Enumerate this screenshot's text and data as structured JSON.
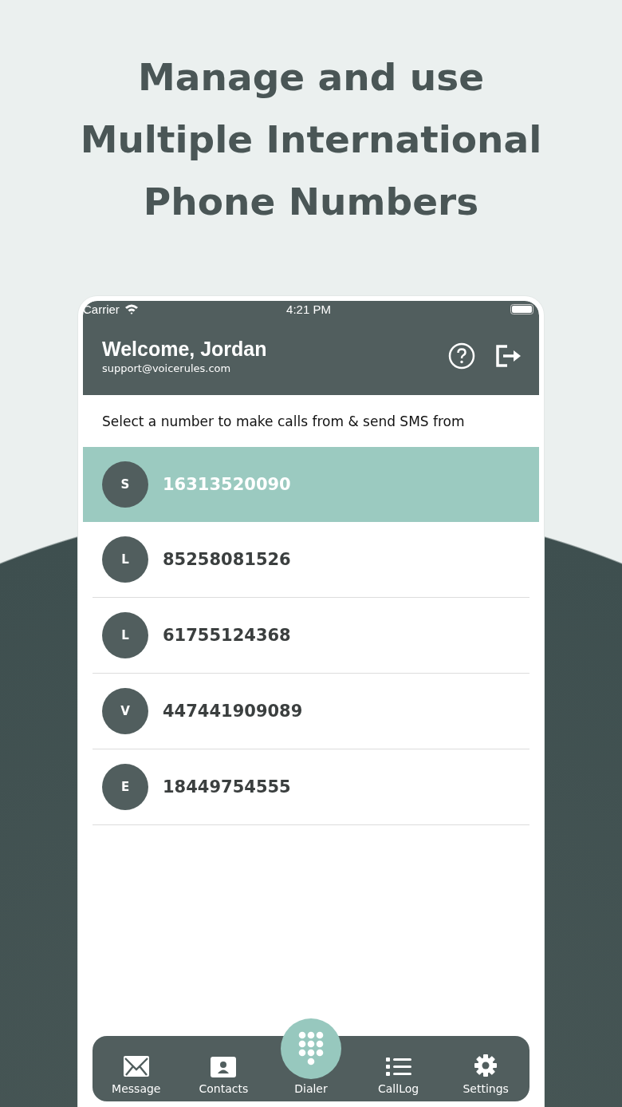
{
  "headline": [
    "Manage and use",
    "Multiple International",
    "Phone Numbers"
  ],
  "status_bar": {
    "carrier": "Carrier",
    "time": "4:21 PM"
  },
  "header": {
    "title": "Welcome, Jordan",
    "email": "support@voicerules.com"
  },
  "instruction": "Select a number to make calls from & send SMS from",
  "numbers": [
    {
      "initial": "S",
      "number": "16313520090",
      "selected": true
    },
    {
      "initial": "L",
      "number": "85258081526",
      "selected": false
    },
    {
      "initial": "L",
      "number": "61755124368",
      "selected": false
    },
    {
      "initial": "V",
      "number": "447441909089",
      "selected": false
    },
    {
      "initial": "E",
      "number": "18449754555",
      "selected": false
    }
  ],
  "tab_bar": [
    {
      "label": "Message",
      "kind": "tab"
    },
    {
      "label": "Contacts",
      "kind": "tab"
    },
    {
      "label": "Dialer",
      "kind": "center"
    },
    {
      "label": "CallLog",
      "kind": "tab"
    },
    {
      "label": "Settings",
      "kind": "tab"
    }
  ]
}
